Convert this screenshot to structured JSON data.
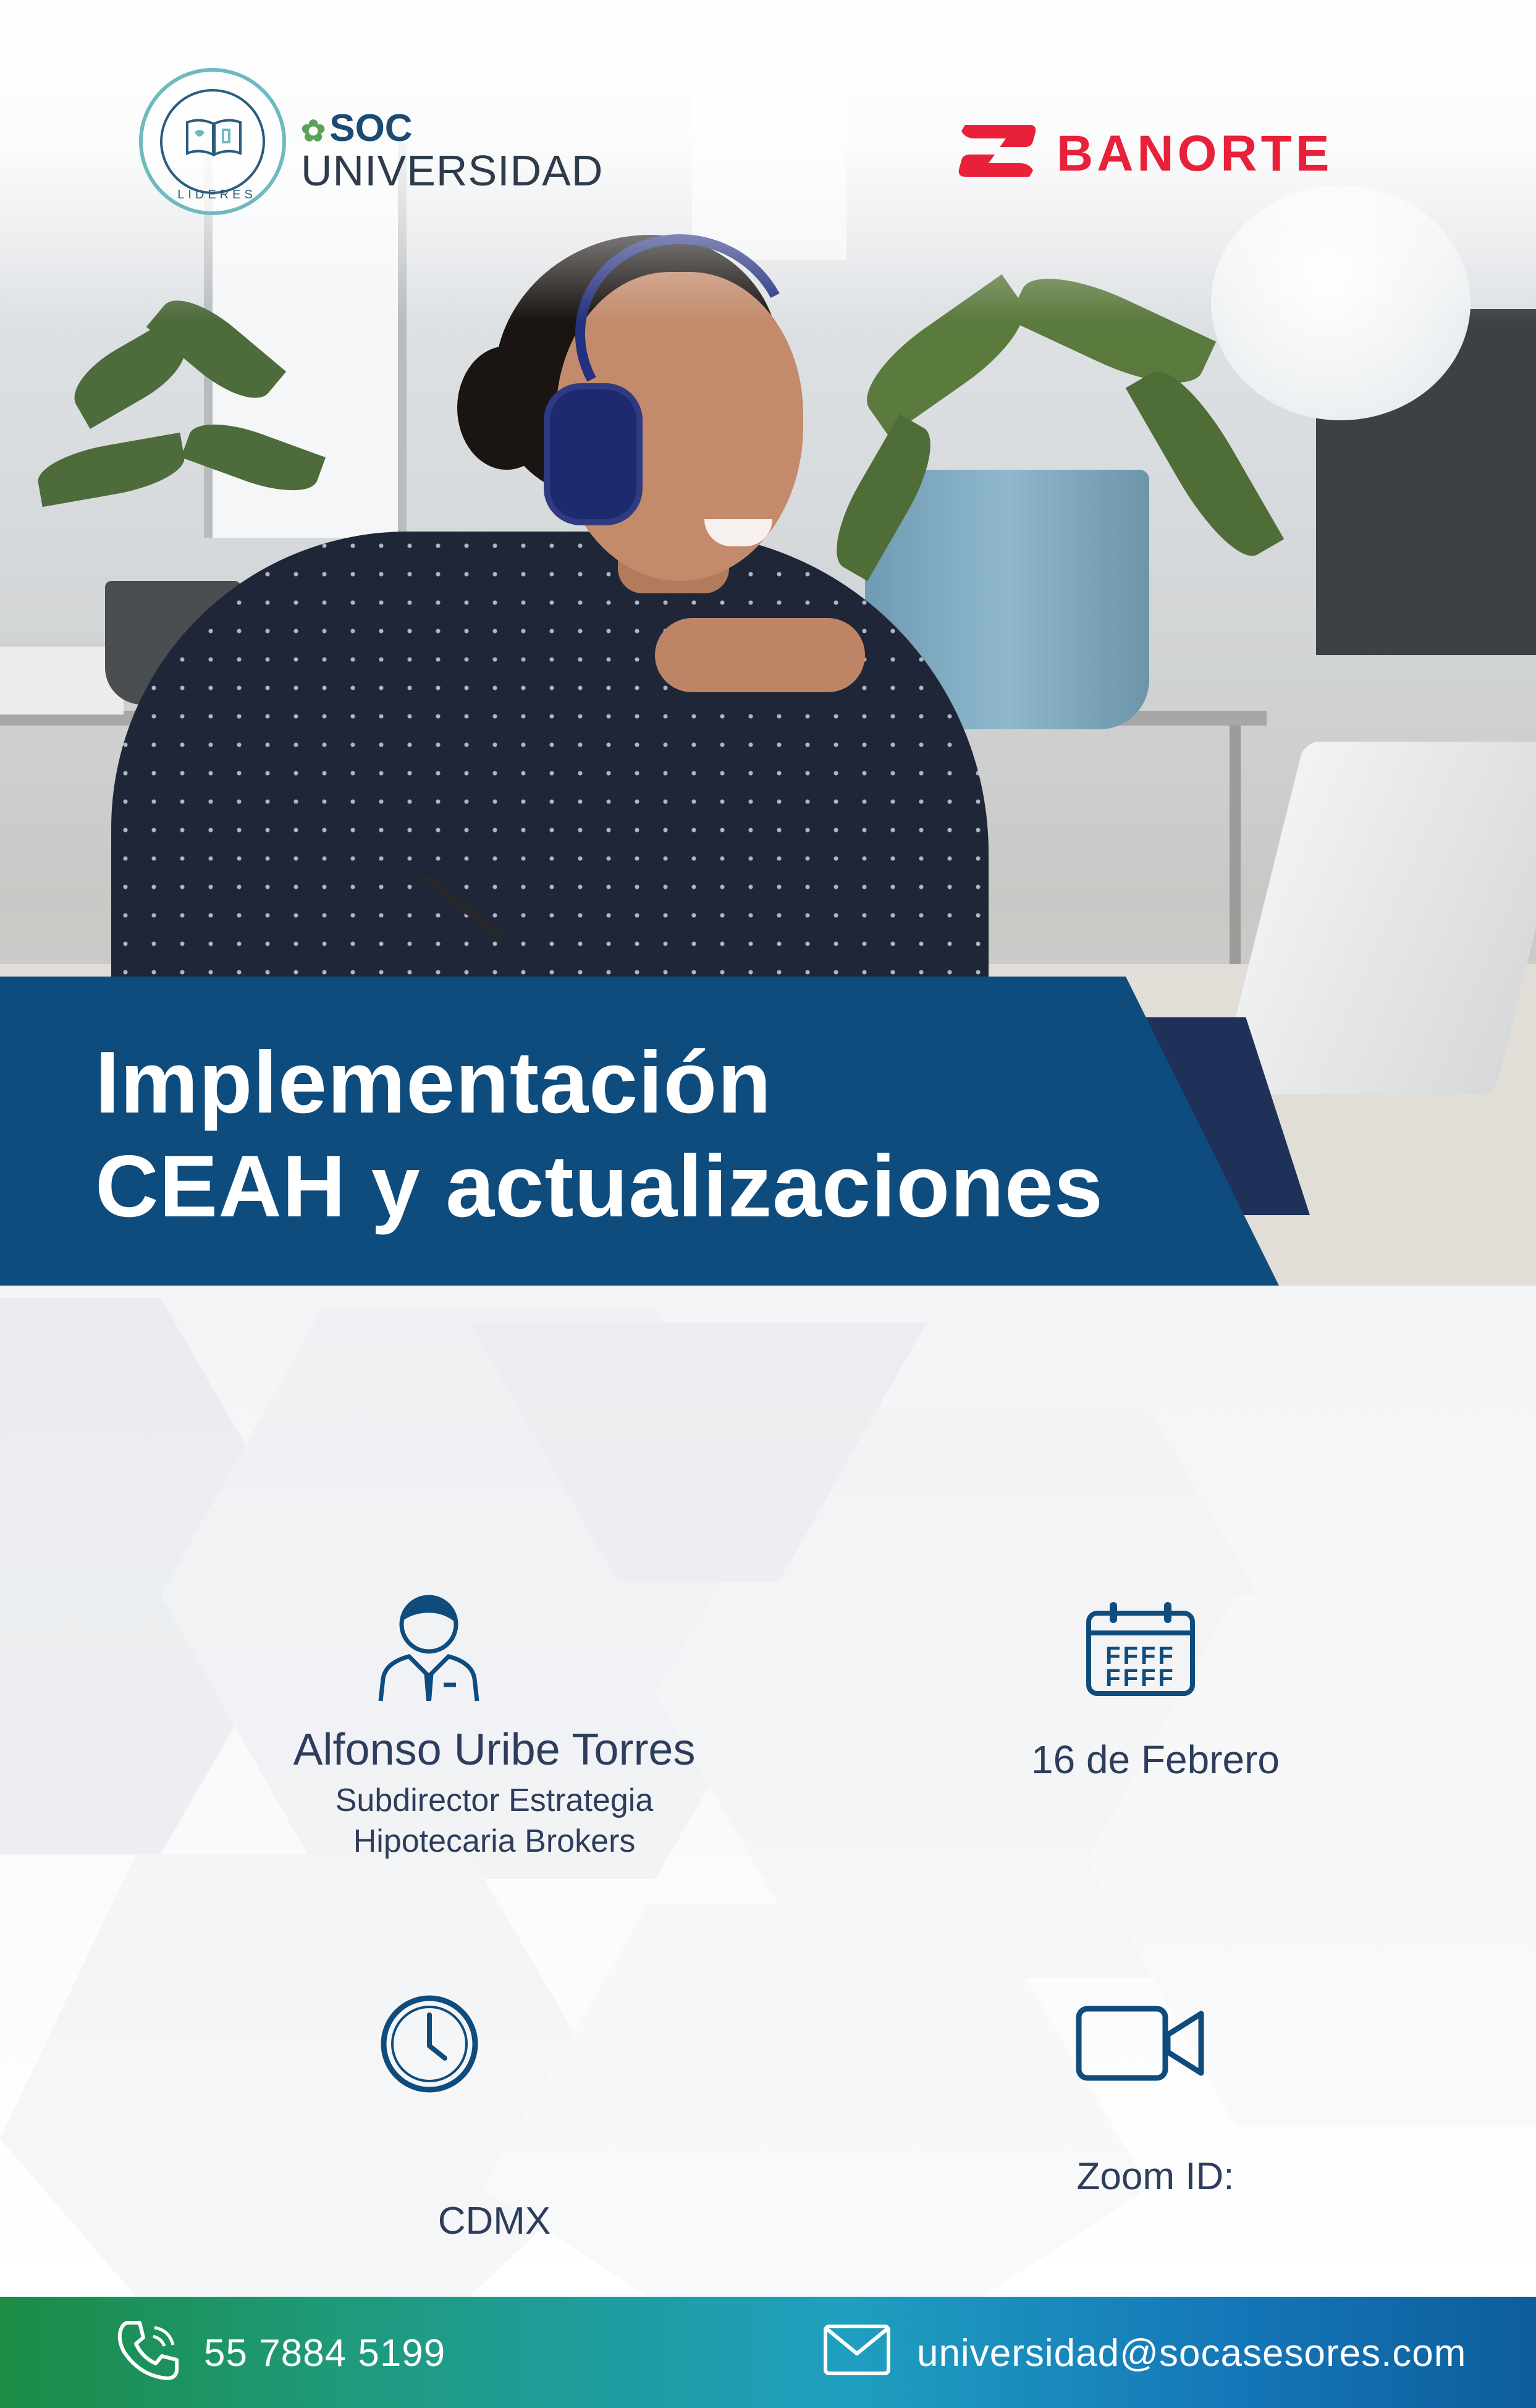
{
  "brand": {
    "soc_mark": "SOC",
    "soc_name": "UNIVERSIDAD",
    "soc_badge_text": "LIDERES",
    "partner": "BANORTE",
    "colors": {
      "navy": "#0f4c7e",
      "banorte_red": "#e8203a",
      "text": "#2e3d5c",
      "green": "#1b8b45"
    }
  },
  "event": {
    "title_line1": "Implementación",
    "title_line2": "CEAH y actualizaciones"
  },
  "details": {
    "speaker_name": "Alfonso Uribe Torres",
    "speaker_role_line1": "Subdirector Estrategia",
    "speaker_role_line2": "Hipotecaria Brokers",
    "date": "16 de Febrero",
    "place": "CDMX",
    "zoom_label": "Zoom ID:"
  },
  "icons": {
    "speaker": "person-icon",
    "date": "calendar-icon",
    "time": "clock-icon",
    "video": "video-camera-icon",
    "phone": "phone-icon",
    "email": "mail-icon"
  },
  "contact": {
    "phone": "55 7884 5199",
    "email": "universidad@socasesores.com"
  }
}
